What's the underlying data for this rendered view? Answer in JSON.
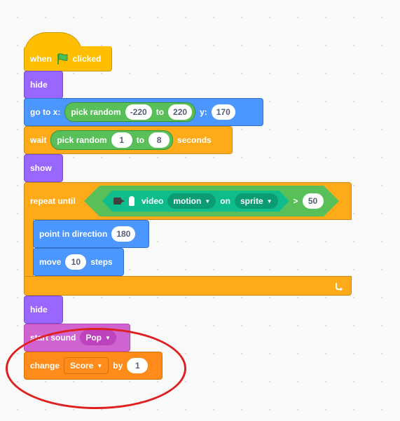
{
  "workspace": {
    "blocks": {
      "when_flag_clicked": {
        "when": "when",
        "clicked": "clicked",
        "flag_icon": "green-flag-icon"
      },
      "hide1": {
        "label": "hide"
      },
      "goto_xy": {
        "label": "go to x:",
        "random_label": "pick random",
        "min": "-220",
        "to": "to",
        "max": "220",
        "y_label": "y:",
        "y_value": "170"
      },
      "wait": {
        "label": "wait",
        "random_label": "pick random",
        "min": "1",
        "to": "to",
        "max": "8",
        "seconds": "seconds"
      },
      "show": {
        "label": "show"
      },
      "repeat_until": {
        "label": "repeat until",
        "video_label": "video",
        "attribute": "motion",
        "on_label": "on",
        "subject": "sprite",
        "operator": ">",
        "value": "50",
        "loop_icon": "loop-arrow-icon",
        "camera_icon": "video-camera-icon"
      },
      "point_direction": {
        "label": "point in direction",
        "value": "180"
      },
      "move": {
        "label": "move",
        "value": "10",
        "steps": "steps"
      },
      "hide2": {
        "label": "hide"
      },
      "start_sound": {
        "label": "start sound",
        "sound": "Pop"
      },
      "change_var": {
        "label": "change",
        "variable": "Score",
        "by": "by",
        "value": "1"
      }
    },
    "colors": {
      "events": "#ffbf00",
      "looks": "#9966ff",
      "motion": "#4c97ff",
      "control": "#ffab19",
      "operators": "#59c059",
      "sound": "#cf63cf",
      "variables": "#ff8c1a",
      "video_extension": "#0fbd8c",
      "highlight": "#e02020"
    }
  }
}
